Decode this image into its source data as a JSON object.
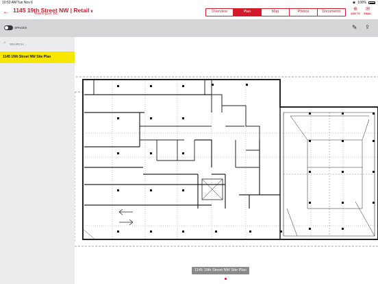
{
  "status": {
    "time": "10:53 AM",
    "date": "Tue Nov 6",
    "battery": "100%"
  },
  "header": {
    "title": "1145 19th Street NW | Retail",
    "subtitle": "Washington, DC",
    "tabs": [
      {
        "label": "Overview",
        "active": false
      },
      {
        "label": "Plan",
        "active": true
      },
      {
        "label": "Map",
        "active": false
      },
      {
        "label": "Photos",
        "active": false
      },
      {
        "label": "Documents",
        "active": false
      }
    ],
    "add_to_label": "ADD TO",
    "email_label": "EMAIL"
  },
  "toolbar": {
    "spaces_label": "SPACES"
  },
  "sidebar": {
    "search_placeholder": "SEARCH...",
    "items": [
      {
        "label": "1145 19th Street NW Site Plan",
        "selected": true
      }
    ]
  },
  "main": {
    "caption": "1145 19th Street NW Site Plan",
    "page_indicator_count": 1
  },
  "colors": {
    "accent": "#d11a2a",
    "highlight": "#f7e600",
    "toolbar": "#d6d6d9",
    "sidebar": "#ececef"
  },
  "icons": [
    "back-arrow-icon",
    "chevron-down-icon",
    "add-to-icon",
    "email-icon",
    "pencil-icon",
    "share-icon",
    "search-icon",
    "wifi-icon",
    "battery-icon"
  ]
}
